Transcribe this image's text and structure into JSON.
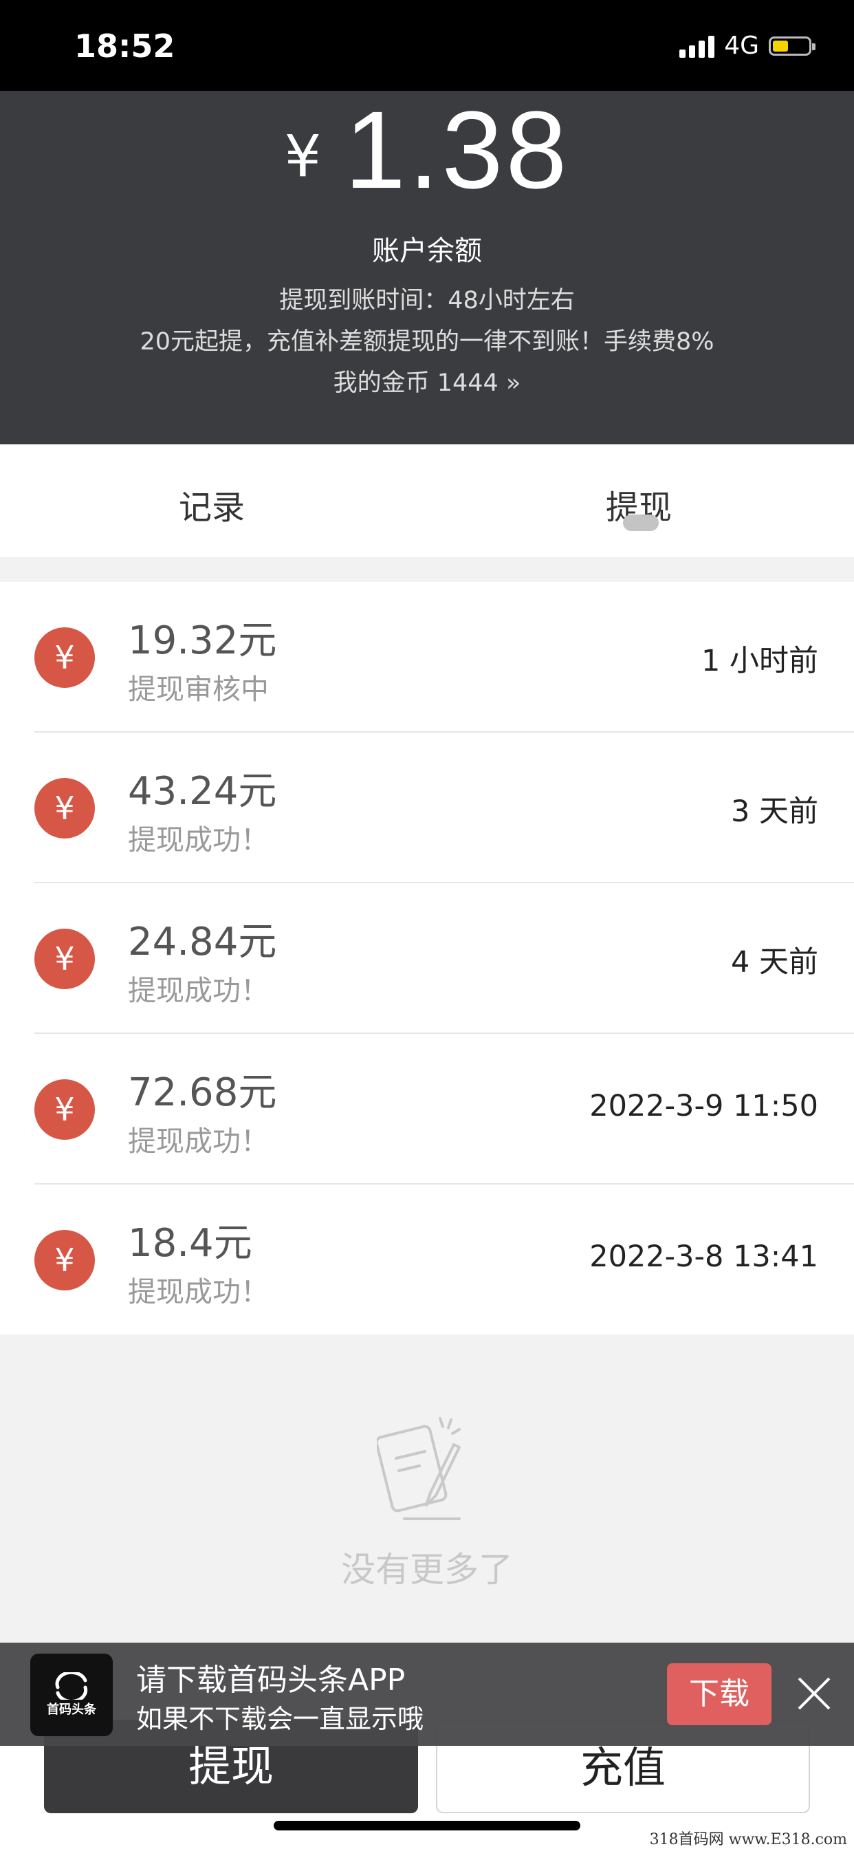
{
  "status_bar": {
    "time": "18:52",
    "network": "4G"
  },
  "header": {
    "currency_symbol": "¥",
    "balance": "1.38",
    "balance_label": "账户余额",
    "arrival_time": "提现到账时间：48小时左右",
    "notice": "20元起提，充值补差额提现的一律不到账！手续费8%",
    "coins": "我的金币 1444 »"
  },
  "tabs": [
    {
      "label": "记录"
    },
    {
      "label": "提现",
      "active": true
    }
  ],
  "records": [
    {
      "icon": "¥",
      "amount": "19.32元",
      "status": "提现审核中",
      "time": "1 小时前"
    },
    {
      "icon": "¥",
      "amount": "43.24元",
      "status": "提现成功！",
      "time": "3 天前"
    },
    {
      "icon": "¥",
      "amount": "24.84元",
      "status": "提现成功！",
      "time": "4 天前"
    },
    {
      "icon": "¥",
      "amount": "72.68元",
      "status": "提现成功！",
      "time": "2022-3-9 11:50"
    },
    {
      "icon": "¥",
      "amount": "18.4元",
      "status": "提现成功！",
      "time": "2022-3-8 13:41"
    }
  ],
  "empty_text": "没有更多了",
  "banner": {
    "logo_text": "首码头条",
    "title": "请下载首码头条APP",
    "subtitle": "如果不下载会一直显示哦",
    "download_label": "下载"
  },
  "buttons": {
    "withdraw": "提现",
    "recharge": "充值"
  },
  "watermark": "318首码网 www.E318.com",
  "colors": {
    "header_bg": "#3b3c3f",
    "yen_icon": "#d65746",
    "download_button": "#e06060",
    "battery": "#f5d400"
  },
  "icons": {
    "signal": "signal-bars-icon",
    "battery": "battery-icon",
    "empty": "note-pen-icon",
    "close": "close-icon"
  }
}
